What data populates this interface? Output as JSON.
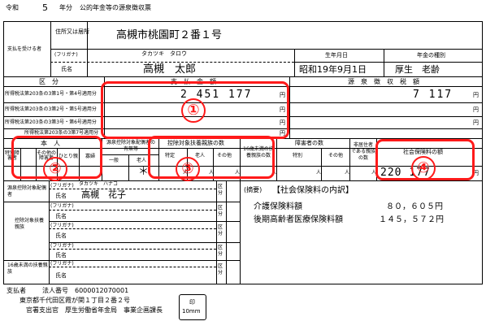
{
  "header": {
    "era": "令和",
    "year": "5",
    "year_unit": "年分",
    "title": "公的年金等の源泉徴収票"
  },
  "recipient": {
    "label": "支払を受ける者",
    "address_label": "住所又は居所",
    "address": "高槻市桃園町２番１号",
    "furigana_label": "(フリガナ)",
    "furigana": "タカツキ　タロウ",
    "name_label": "氏名",
    "name": "高槻　太郎",
    "birth_label": "生年月日",
    "birth": "昭和19年9月1日",
    "pension_type_label": "年金の種別",
    "pension_type": "厚生　老齢"
  },
  "payment": {
    "division_label": "区　分",
    "amount_label": "支　払　金　額",
    "withholding_label": "源　泉　徴　収　税　額",
    "rows": [
      "所得税法第203条の3第1号・第4号適用分",
      "所得税法第203条の3第2号・第5号適用分",
      "所得税法第203条の3第3号・第6号適用分",
      "所得税法第203条の3第7号適用分"
    ],
    "amount": "2 451 177",
    "withholding": "7 117",
    "yen": "円"
  },
  "mid": {
    "self_label": "本　人",
    "special_disabled": "特別障害者",
    "other_disabled": "その他の障害者",
    "single": "ひとり親",
    "widow": "寡婦",
    "spouse_label": "源泉控除対象配偶者の有無等",
    "general": "一般",
    "elderly": "老人",
    "dependents_label": "控除対象扶養親族の数",
    "specific": "特定",
    "dep_elderly": "老人",
    "other": "その他",
    "under16": "16歳未満の扶養親族の数",
    "disabled_count_label": "障害者の数",
    "special": "特別",
    "sono_ta": "その他",
    "nonresident": "非居住者である親族の数",
    "social_label": "社会保険料の額",
    "spouse_mark": "＊",
    "person": "人",
    "social_amount": "220 177",
    "yen": "円"
  },
  "lower": {
    "spouse_section": "源泉控除対象配偶者",
    "furigana_label": "(フリガナ)",
    "spouse_furigana": "タカツキ　ハナコ",
    "name_label": "氏名",
    "spouse_name": "高槻　花子",
    "kubun": "区分",
    "dependents_section": "控除対象扶養親族",
    "under16_section": "16歳未満の扶養親族",
    "summary_label": "(摘要)",
    "summary_title": "【社会保険料の内訳】",
    "items": [
      {
        "label": "介護保険料額",
        "value": "８０，６０５円"
      },
      {
        "label": "後期高齢者医療保険料額",
        "value": "１４５，５７２円"
      }
    ]
  },
  "payer": {
    "label": "支払者",
    "corp_no_label": "法人番号",
    "corp_no": "6000012070001",
    "address": "東京都千代田区霞が関１丁目２番２号",
    "officer": "官署支出官　厚生労働省年金局　事業企画課長",
    "seal_line1": "印",
    "seal_line2": "10mm"
  },
  "badges": [
    "①",
    "②",
    "③",
    "④"
  ]
}
